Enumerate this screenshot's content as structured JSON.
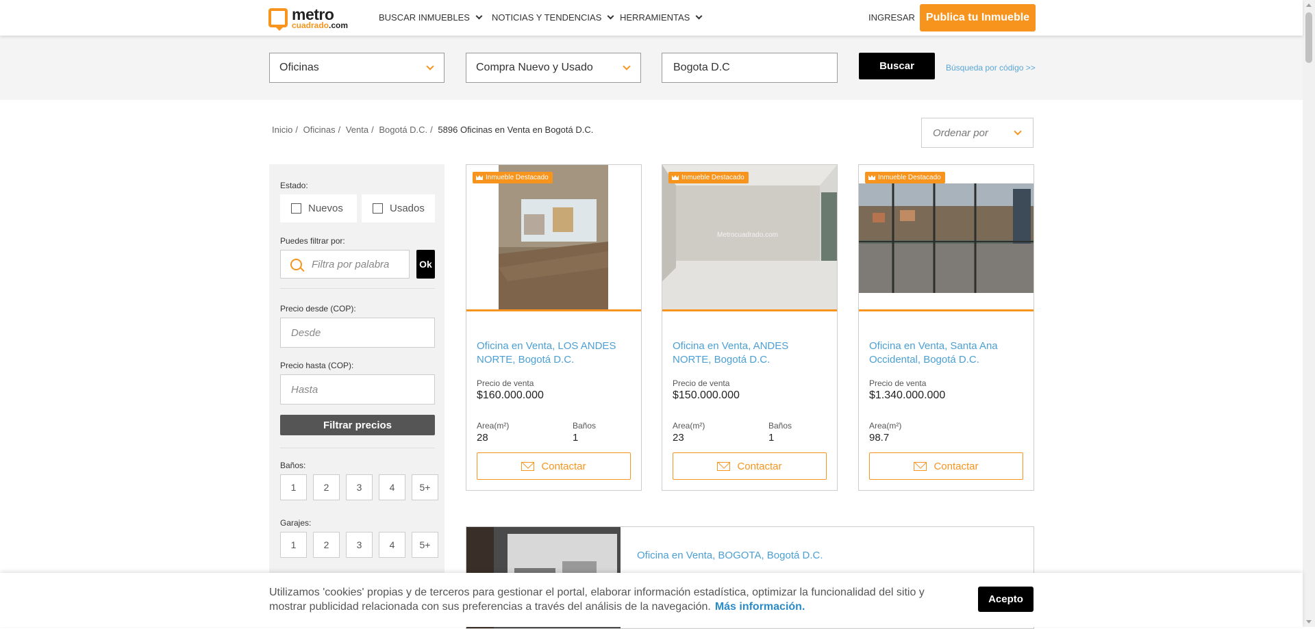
{
  "header": {
    "logo_main": "metro",
    "logo_sub_orange": "cuadrado",
    "logo_sub_dark": ".com",
    "nav": [
      "BUSCAR INMUEBLES",
      "NOTICIAS Y TENDENCIAS",
      "HERRAMIENTAS"
    ],
    "login": "INGRESAR",
    "publish": "Publica tu Inmueble"
  },
  "search": {
    "property_type": "Oficinas",
    "transaction": "Compra Nuevo y Usado",
    "location": "Bogota D.C",
    "button": "Buscar",
    "code_link": "Búsqueda por código >>"
  },
  "breadcrumb": {
    "items": [
      "Inicio",
      "Oficinas",
      "Venta",
      "Bogotá D.C."
    ],
    "separator": "/",
    "current": "5896 Oficinas en Venta en Bogotá D.C."
  },
  "sort": {
    "placeholder": "Ordenar por"
  },
  "filters": {
    "estado_label": "Estado:",
    "nuevos": "Nuevos",
    "usados": "Usados",
    "word_label": "Puedes filtrar por:",
    "word_placeholder": "Filtra por palabra",
    "ok": "Ok",
    "desde_label": "Precio desde (COP):",
    "desde_placeholder": "Desde",
    "hasta_label": "Precio hasta (COP):",
    "hasta_placeholder": "Hasta",
    "filter_button": "Filtrar precios",
    "banos_label": "Baños:",
    "banos_options": [
      "1",
      "2",
      "3",
      "4",
      "5+"
    ],
    "garajes_label": "Garajes:",
    "garajes_options": [
      "1",
      "2",
      "3",
      "4",
      "5+"
    ]
  },
  "listings": [
    {
      "badge": "Inmueble Destacado",
      "title": "Oficina en Venta, LOS ANDES NORTE, Bogotá D.C.",
      "price_label": "Precio de venta",
      "price": "$160.000.000",
      "area_label": "Area(m²)",
      "area": "28",
      "banos_label": "Baños",
      "banos": "1",
      "contact": "Contactar"
    },
    {
      "badge": "Inmueble Destacado",
      "title": "Oficina en Venta, ANDES NORTE, Bogotá D.C.",
      "price_label": "Precio de venta",
      "price": "$150.000.000",
      "area_label": "Area(m²)",
      "area": "23",
      "banos_label": "Baños",
      "banos": "1",
      "contact": "Contactar",
      "watermark": "Metrocuadrado.com"
    },
    {
      "badge": "Inmueble Destacado",
      "title": "Oficina en Venta, Santa Ana Occidental, Bogotá D.C.",
      "price_label": "Precio de venta",
      "price": "$1.340.000.000",
      "area_label": "Area(m²)",
      "area": "98.7",
      "contact": "Contactar"
    }
  ],
  "horizontal_listing": {
    "title": "Oficina en Venta, BOGOTA, Bogotá D.C."
  },
  "cookie": {
    "text": "Utilizamos 'cookies' propias y de terceros para gestionar el portal, elaborar información estadística, optimizar la funcionalidad del sitio y mostrar publicidad relacionada con sus preferencias a través del análisis de la navegación.",
    "more": "Más información.",
    "accept": "Acepto"
  },
  "colors": {
    "accent": "#f7941d",
    "link": "#4b9fd5",
    "sidebar_bg": "#f2f2f2"
  }
}
